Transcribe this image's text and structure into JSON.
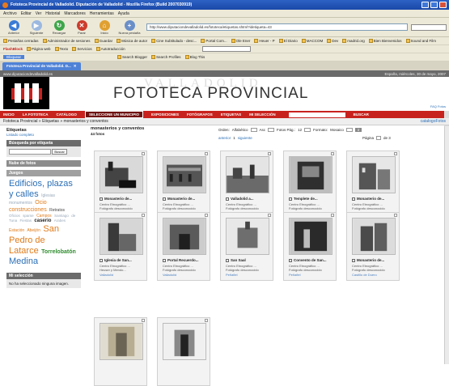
{
  "window": {
    "title": "Fototeca Provincial de Valladolid. Diputación de Valladolid - Mozilla Firefox (Build 2007030919)"
  },
  "menu": [
    "Archivo",
    "Editar",
    "Ver",
    "Historial",
    "Marcadores",
    "Herramientas",
    "Ayuda"
  ],
  "nav": {
    "back": "Anterior",
    "forward": "Siguiente",
    "reload": "Recargar",
    "stop": "Parar",
    "home": "Inicio",
    "new_tab": "Nueva pestaña",
    "url": "http://www.diputaciondevalladolid.es/fototeca/etiquetas.shtml?idetiqueta=43"
  },
  "bookmarks1": [
    "Pestañas cerradas",
    "Administrador de sesiones",
    "Guardar",
    "Música de autor",
    "Cine Subtitulado - desc...",
    "Portal Com...",
    "Ole Ener",
    "Heuer - P",
    "El Diario",
    "MACCOM",
    "Dev",
    "madrid.org",
    "Bien Bienvenidos",
    "Sound and Film"
  ],
  "bookmarks2": [
    "FlashBlock",
    "Página web",
    "Texto",
    "Servicios",
    "Autotraducción"
  ],
  "bookmarks3": [
    "Bloquear",
    "Search Blogger",
    "Search Profiles",
    "Blog This"
  ],
  "tab": {
    "label": "Fototeca Provincial de Valladolid. D..."
  },
  "banner": {
    "top_left": "www.diputaciondevalladolid.es",
    "top_right": "España, miércoles, 30 de mayo, 2007",
    "watermark": "VALLADOLID",
    "site_title": "FOTOTECA PROVINCIAL",
    "small_link": "FAQ Fotos"
  },
  "mainnav": [
    "INICIO",
    "LA FOTOTECA",
    "CATÁLOGO",
    "SELECCIONE UN MUNICIPIO",
    "EXPOSICIONES",
    "FOTÓGRAFOS",
    "ETIQUETAS",
    "MI SELECCIÓN",
    "BUSCAR"
  ],
  "breadcrumb": {
    "path": "Fototeca Provincial » Etiquetas » monasterios y conventos",
    "right": "catalogoFotos"
  },
  "sidebar": {
    "tags_header": "Etiquetas",
    "tags_link": "Listado completo",
    "search_header": "Búsqueda por etiqueta",
    "search_button": "Buscar",
    "nube_link": "Nube de fotos",
    "juegos": "Juegos",
    "cloud": [
      "Edificios, plazas",
      "y calles",
      "Iglesias",
      "monumentos",
      "Ocio",
      "construcciones",
      "Retratos",
      "Oficios",
      "sparse",
      "Campos",
      "Santiago",
      "de Tuna",
      "Fiestas",
      "caserio",
      "Arabes",
      "Estación",
      "Abeijón",
      "San",
      "Pedro de Latarce",
      "Torrelobatón",
      "Medina"
    ],
    "sel_header": "Mi selección",
    "sel_text": "No ha seleccionado ninguna imagen."
  },
  "main": {
    "title": "monasterios y conventos",
    "count": "44 fotos",
    "order_label": "Orden:",
    "order_val": "Alfabético",
    "dir_val": "Asc",
    "perpage_label": "Fotos Pág.:",
    "perpage_val": "12",
    "format_label": "Formato:",
    "format_val": "Mosaico",
    "go": "ir",
    "prev": "anterior",
    "pages": "1",
    "next": "siguiente",
    "page_label": "Página",
    "page_of": "de 3"
  },
  "cards": [
    {
      "title": "Monasterio de...",
      "l1": "Centro Etnográfico ...",
      "l2": "Fotógrafo desconocido",
      "l3": "La Santa Espina"
    },
    {
      "title": "Monasterio de...",
      "l1": "Centro Etnográfico ...",
      "l2": "Fotógrafo desconocido",
      "l3": "Medina del Campo"
    },
    {
      "title": "Valladolid a...",
      "l1": "Centro Etnográfico ...",
      "l2": "Fotógrafo desconocido",
      "l3": "Valladolid"
    },
    {
      "title": "Templete de...",
      "l1": "Centro Etnográfico ...",
      "l2": "Fotógrafo desconocido",
      "l3": "Medina de Rioseco"
    },
    {
      "title": "Monasterio de...",
      "l1": "Centro Etnográfico ...",
      "l2": "Fotógrafo desconocido",
      "l3": "Villafrechós"
    },
    {
      "title": "Iglesia de San...",
      "l1": "Centro Etnográfico ...",
      "l2": "Heuser y Mendo...",
      "l3": "Valladolid"
    },
    {
      "title": "Portal Recuerdo...",
      "l1": "Centro Etnográfico ...",
      "l2": "Fotógrafo desconocido",
      "l3": "Valladolid"
    },
    {
      "title": "San Saal",
      "l1": "Centro Etnográfico ...",
      "l2": "Fotógrafo desconocido",
      "l3": "Peñafiel"
    },
    {
      "title": "Convento de San...",
      "l1": "Centro Etnográfico ...",
      "l2": "Fotógrafo desconocido",
      "l3": "Peñafiel"
    },
    {
      "title": "Monasterio de...",
      "l1": "Centro Etnográfico ...",
      "l2": "Fotógrafo desconocido",
      "l3": "Castillo de Duero"
    },
    {
      "title": "",
      "l1": "",
      "l2": "",
      "l3": ""
    },
    {
      "title": "",
      "l1": "",
      "l2": "",
      "l3": ""
    }
  ],
  "colors": {
    "nav_red": "#c8221e",
    "accent_orange": "#e07b1a",
    "link_blue": "#2b6fb7"
  }
}
